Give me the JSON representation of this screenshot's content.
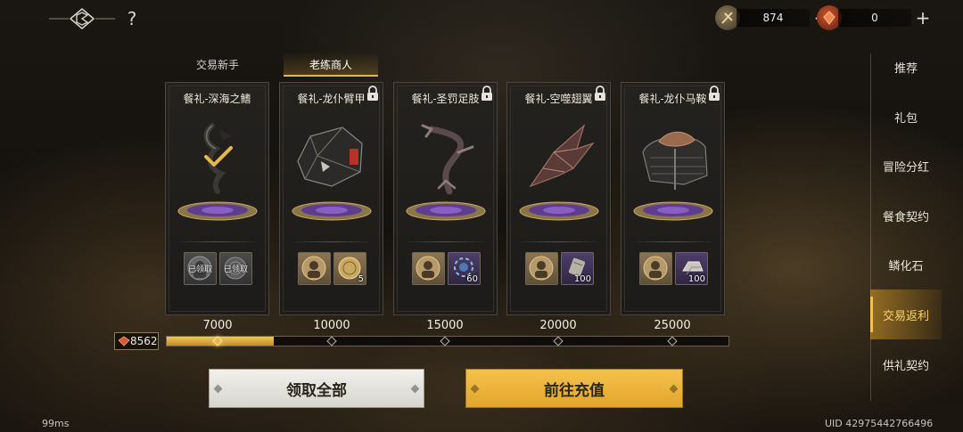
{
  "topbar": {
    "logo_icon": "game-emblem-icon",
    "help_label": "?",
    "currencies": [
      {
        "icon": "gold-coin-token-icon",
        "amount": "874",
        "plus": "+"
      },
      {
        "icon": "red-gem-icon",
        "amount": "0",
        "plus": "+"
      }
    ]
  },
  "tabs": [
    {
      "label": "交易新手",
      "active": false
    },
    {
      "label": "老练商人",
      "active": true
    }
  ],
  "cards": [
    {
      "title": "餐礼-深海之鳍",
      "locked": false,
      "art": "dark-blade-relic-icon",
      "claimed_check": true,
      "rewards": [
        {
          "icon": "portrait-token-icon",
          "qty": "",
          "status": "已领取"
        },
        {
          "icon": "coin-medal-icon",
          "qty": "",
          "status": "已领取"
        }
      ]
    },
    {
      "title": "餐礼-龙仆臂甲",
      "locked": true,
      "art": "dragon-armguard-icon",
      "claimed_check": false,
      "rewards": [
        {
          "icon": "portrait-token-icon",
          "qty": "",
          "status": ""
        },
        {
          "icon": "coin-medal-icon",
          "qty": "5",
          "status": ""
        }
      ]
    },
    {
      "title": "餐礼-圣罚足肢",
      "locked": true,
      "art": "claw-limb-icon",
      "claimed_check": false,
      "rewards": [
        {
          "icon": "portrait-token-icon",
          "qty": "",
          "status": ""
        },
        {
          "icon": "blue-orb-icon",
          "qty": "60",
          "status": ""
        }
      ]
    },
    {
      "title": "餐礼-空噬翅翼",
      "locked": true,
      "art": "void-wing-icon",
      "claimed_check": false,
      "rewards": [
        {
          "icon": "portrait-token-icon",
          "qty": "",
          "status": ""
        },
        {
          "icon": "scroll-icon",
          "qty": "100",
          "status": ""
        }
      ]
    },
    {
      "title": "餐礼-龙仆马鞍",
      "locked": true,
      "art": "dragon-saddle-icon",
      "claimed_check": false,
      "rewards": [
        {
          "icon": "portrait-token-icon",
          "qty": "",
          "status": ""
        },
        {
          "icon": "silver-ingot-icon",
          "qty": "100",
          "status": ""
        }
      ]
    }
  ],
  "milestones": [
    "7000",
    "10000",
    "15000",
    "20000",
    "25000"
  ],
  "progress": {
    "balance_icon": "red-gem-icon",
    "balance": "8562",
    "fill_fraction": 0.19,
    "reached_count": 1
  },
  "buttons": {
    "claim_all": "领取全部",
    "recharge": "前往充值"
  },
  "side_menu": [
    {
      "label": "推荐",
      "active": false
    },
    {
      "label": "礼包",
      "active": false
    },
    {
      "label": "冒险分红",
      "active": false
    },
    {
      "label": "餐食契约",
      "active": false
    },
    {
      "label": "鳞化石",
      "active": false
    },
    {
      "label": "交易返利",
      "active": true
    },
    {
      "label": "供礼契约",
      "active": false
    }
  ],
  "footer": {
    "latency": "99ms",
    "uid": "UID 42975442766496"
  },
  "colors": {
    "accent_gold": "#e7b648",
    "recharge_button": "#e9b033",
    "claim_button": "#e6e4df"
  }
}
